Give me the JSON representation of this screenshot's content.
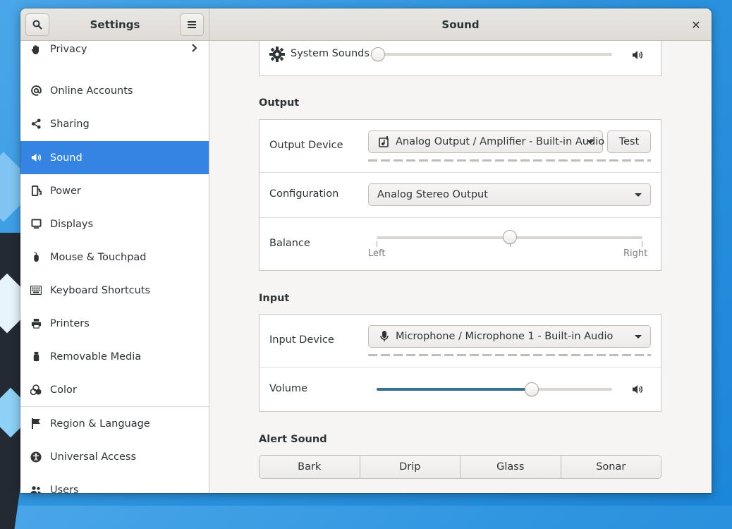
{
  "window": {
    "sidebar_title": "Settings",
    "panel_title": "Sound"
  },
  "colors": {
    "accent": "#3584e4",
    "slider_fill": "#3a6f94"
  },
  "sidebar": {
    "items": [
      {
        "label": "Privacy",
        "icon": "hand-icon",
        "has_chevron": true
      },
      {
        "label": "Online Accounts",
        "icon": "at-icon"
      },
      {
        "label": "Sharing",
        "icon": "share-icon"
      },
      {
        "label": "Sound",
        "icon": "speaker-icon",
        "selected": true
      },
      {
        "label": "Power",
        "icon": "power-plug-icon"
      },
      {
        "label": "Displays",
        "icon": "display-icon"
      },
      {
        "label": "Mouse & Touchpad",
        "icon": "mouse-icon"
      },
      {
        "label": "Keyboard Shortcuts",
        "icon": "keyboard-icon"
      },
      {
        "label": "Printers",
        "icon": "printer-icon"
      },
      {
        "label": "Removable Media",
        "icon": "usb-icon"
      },
      {
        "label": "Color",
        "icon": "color-icon"
      },
      {
        "label": "Region & Language",
        "icon": "flag-icon"
      },
      {
        "label": "Universal Access",
        "icon": "accessibility-icon"
      },
      {
        "label": "Users",
        "icon": "users-icon"
      }
    ]
  },
  "system_sounds": {
    "label": "System Sounds",
    "volume_fraction": 0.0
  },
  "output": {
    "title": "Output",
    "device_label": "Output Device",
    "device_value": "Analog Output / Amplifier - Built-in Audio",
    "test_label": "Test",
    "config_label": "Configuration",
    "config_value": "Analog Stereo Output",
    "balance_label": "Balance",
    "balance_left": "Left",
    "balance_right": "Right",
    "balance_fraction": 0.5
  },
  "input": {
    "title": "Input",
    "device_label": "Input Device",
    "device_value": "Microphone / Microphone 1 - Built-in Audio",
    "volume_label": "Volume",
    "volume_fraction": 0.66
  },
  "alert_sound": {
    "title": "Alert Sound",
    "options": [
      "Bark",
      "Drip",
      "Glass",
      "Sonar"
    ]
  }
}
